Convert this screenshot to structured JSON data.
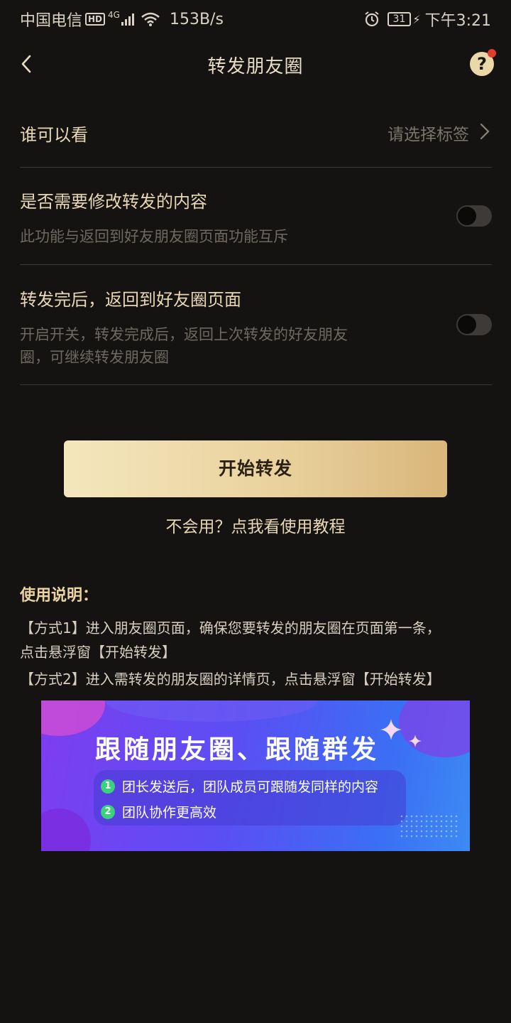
{
  "status_bar": {
    "carrier": "中国电信",
    "hd": "HD",
    "network": "4G",
    "speed": "153B/s",
    "battery": "31",
    "time": "下午3:21"
  },
  "nav": {
    "title": "转发朋友圈",
    "help": "?"
  },
  "settings": {
    "visibility": {
      "label": "谁可以看",
      "value": "请选择标签"
    },
    "edit_content": {
      "label": "是否需要修改转发的内容",
      "desc": "此功能与返回到好友朋友圈页面功能互斥",
      "enabled": false
    },
    "return_after": {
      "label": "转发完后，返回到好友圈页面",
      "desc_line1": "开启开关，转发完成后，返回上次转发的好友朋友",
      "desc_line2": "圈，可继续转发朋友圈",
      "enabled": false
    }
  },
  "actions": {
    "start": "开始转发",
    "tutorial": "不会用？点我看使用教程"
  },
  "usage": {
    "heading": "使用说明：",
    "line1": "【方式1】进入朋友圈页面，确保您要转发的朋友圈在页面第一条，",
    "line2": "点击悬浮窗【开始转发】",
    "line3": "【方式2】进入需转发的朋友圈的详情页，点击悬浮窗【开始转发】"
  },
  "banner": {
    "title": "跟随朋友圈、跟随群发",
    "items": [
      {
        "num": "1",
        "text": "团长发送后，团队成员可跟随发同样的内容"
      },
      {
        "num": "2",
        "text": "团队协作更高效"
      }
    ]
  },
  "colors": {
    "background": "#151312",
    "accent_gold": "#e8d7b4",
    "button_gradient_start": "#f4e7bd",
    "button_gradient_end": "#d9b67a",
    "notification_dot": "#e33b2f"
  }
}
